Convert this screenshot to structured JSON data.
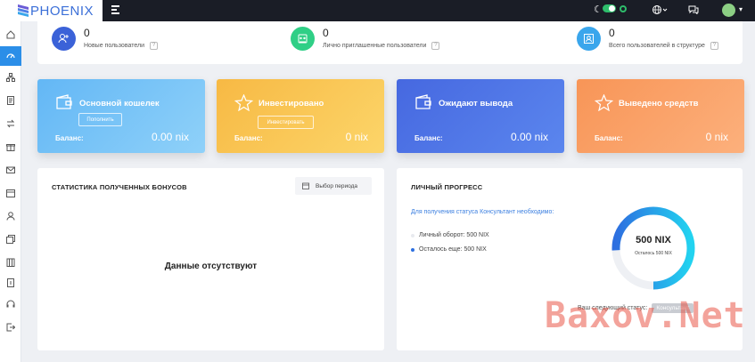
{
  "brand": {
    "name": "PHOENIX"
  },
  "stats": [
    {
      "value": "0",
      "label": "Новые пользователи",
      "icon": "add-user-icon",
      "color": "#3b62d8"
    },
    {
      "value": "0",
      "label": "Лично приглашенные пользователи",
      "icon": "people-group-icon",
      "color": "#2fcf86"
    },
    {
      "value": "0",
      "label": "Всего пользователей в структуре",
      "icon": "user-card-icon",
      "color": "#3aa6ec"
    }
  ],
  "wallets": [
    {
      "title": "Основной кошелек",
      "button": "Пополнить",
      "balance_label": "Баланс:",
      "balance": "0.00 nix",
      "icon": "wallet-icon",
      "color_from": "#63b7f5",
      "color_to": "#8fd1f9"
    },
    {
      "title": "Инвестировано",
      "button": "Инвестировать",
      "balance_label": "Баланс:",
      "balance": "0 nix",
      "icon": "star-badge-icon",
      "color_from": "#f7b944",
      "color_to": "#fcd569"
    },
    {
      "title": "Ожидают вывода",
      "button": "",
      "balance_label": "Баланс:",
      "balance": "0.00 nix",
      "icon": "wallet-icon",
      "color_from": "#4668e0",
      "color_to": "#5b86ee"
    },
    {
      "title": "Выведено средств",
      "button": "",
      "balance_label": "Баланс:",
      "balance": "0 nix",
      "icon": "star-badge-icon",
      "color_from": "#f89557",
      "color_to": "#fcb07c"
    }
  ],
  "bonus": {
    "title": "СТАТИСТИКА ПОЛУЧЕННЫХ БОНУСОВ",
    "period_label": "Выбор периода",
    "empty_text": "Данные отсутствуют"
  },
  "progress": {
    "title": "ЛИЧНЫЙ ПРОГРЕСС",
    "info": "Для получения статуса Консультант необходимо:",
    "personal_turnover": "Личный оборот: 500 NIX",
    "remaining": "Осталось еще: 500 NIX",
    "gauge_value": "500 NIX",
    "gauge_sub": "Осталось 500 NIX",
    "gauge_fraction": 0.0,
    "next_status_label": "Ваш следующий статус:",
    "next_status": "Консультант",
    "colors": {
      "ring_from": "#2d6fe0",
      "ring_to": "#22d3f0",
      "track": "#eef0f4"
    }
  },
  "watermark": "Baxov.Net",
  "sidebar_icons": [
    "home-icon",
    "dashboard-icon",
    "structure-icon",
    "document-icon",
    "transfer-icon",
    "gift-icon",
    "mail-icon",
    "calendar-icon",
    "user-icon",
    "cards-icon",
    "building-icon",
    "notebook-icon",
    "headset-icon",
    "logout-icon"
  ]
}
